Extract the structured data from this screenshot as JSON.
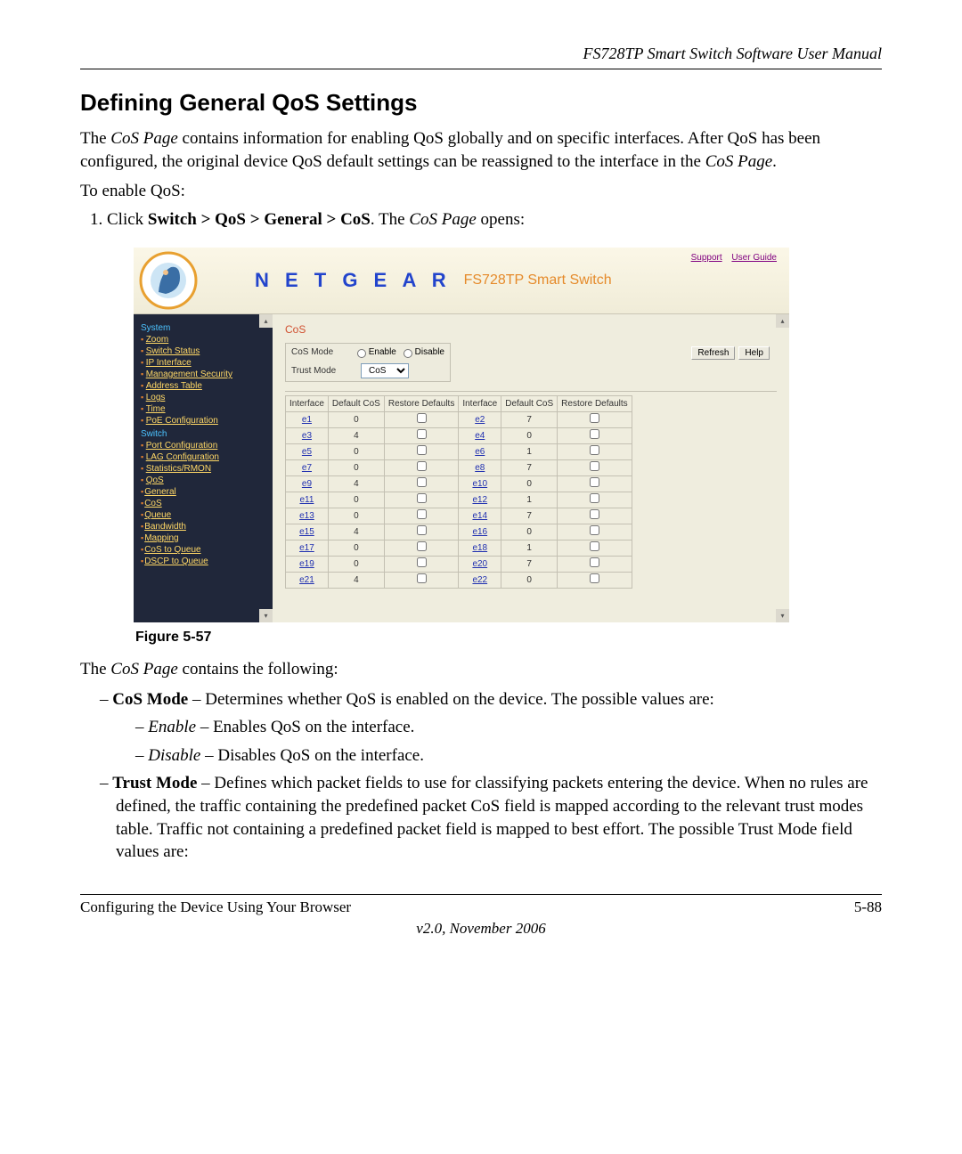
{
  "doc": {
    "header_title": "FS728TP Smart Switch Software User Manual",
    "section_heading": "Defining General QoS Settings",
    "intro_p1_a": "The ",
    "intro_p1_b": "CoS Page",
    "intro_p1_c": " contains information for enabling QoS globally and on specific interfaces. After QoS has been configured, the original device QoS default settings can be reassigned to the interface in the ",
    "intro_p1_d": "CoS Page",
    "intro_p1_e": ".",
    "enable_line": "To enable QoS:",
    "step1_a": "Click ",
    "step1_b": "Switch > QoS > General > CoS",
    "step1_c": ". The ",
    "step1_d": "CoS Page",
    "step1_e": " opens:",
    "figure_caption": "Figure 5-57",
    "contains_line_a": "The ",
    "contains_line_b": "CoS Page",
    "contains_line_c": " contains the following:",
    "bullets": {
      "cos_mode_label": "CoS Mode",
      "cos_mode_text": " – Determines whether QoS is enabled on the device. The possible values are:",
      "enable_label": "Enable",
      "enable_text": " – Enables QoS on the interface.",
      "disable_label": "Disable",
      "disable_text": " – Disables QoS on the interface.",
      "trust_mode_label": "Trust Mode",
      "trust_mode_text": " – Defines which packet fields to use for classifying packets entering the device. When no rules are defined, the traffic containing the predefined packet CoS field is mapped according to the relevant trust modes table. Traffic not containing a predefined packet field is mapped to best effort. The possible Trust Mode field values are:"
    },
    "footer_left": "Configuring the Device Using Your Browser",
    "footer_right": "5-88",
    "footer_version": "v2.0, November 2006"
  },
  "screenshot": {
    "brand": "N E T G E A R",
    "product": "FS728TP Smart Switch",
    "top_links": {
      "support": "Support",
      "user_guide": "User Guide"
    },
    "sidebar": {
      "group_system": "System",
      "items_system": [
        "Zoom",
        "Switch Status",
        "IP Interface",
        "Management Security",
        "Address Table",
        "Logs",
        "Time",
        "PoE Configuration"
      ],
      "group_switch": "Switch",
      "items_switch": [
        "Port Configuration",
        "LAG Configuration",
        "Statistics/RMON",
        "QoS"
      ],
      "general_label": "General",
      "general_children": [
        "CoS",
        "Queue",
        "Bandwidth"
      ],
      "mapping_label": "Mapping",
      "mapping_children": [
        "CoS to Queue",
        "DSCP to Queue"
      ]
    },
    "panel": {
      "title": "CoS",
      "refresh": "Refresh",
      "help": "Help",
      "form": {
        "cos_mode_label": "CoS Mode",
        "enable": "Enable",
        "disable": "Disable",
        "trust_mode_label": "Trust Mode",
        "trust_select": "CoS"
      },
      "table": {
        "headers": [
          "Interface",
          "Default CoS",
          "Restore Defaults",
          "Interface",
          "Default CoS",
          "Restore Defaults"
        ],
        "rows": [
          {
            "l_if": "e1",
            "l_cos": "0",
            "r_if": "e2",
            "r_cos": "7"
          },
          {
            "l_if": "e3",
            "l_cos": "4",
            "r_if": "e4",
            "r_cos": "0"
          },
          {
            "l_if": "e5",
            "l_cos": "0",
            "r_if": "e6",
            "r_cos": "1"
          },
          {
            "l_if": "e7",
            "l_cos": "0",
            "r_if": "e8",
            "r_cos": "7"
          },
          {
            "l_if": "e9",
            "l_cos": "4",
            "r_if": "e10",
            "r_cos": "0"
          },
          {
            "l_if": "e11",
            "l_cos": "0",
            "r_if": "e12",
            "r_cos": "1"
          },
          {
            "l_if": "e13",
            "l_cos": "0",
            "r_if": "e14",
            "r_cos": "7"
          },
          {
            "l_if": "e15",
            "l_cos": "4",
            "r_if": "e16",
            "r_cos": "0"
          },
          {
            "l_if": "e17",
            "l_cos": "0",
            "r_if": "e18",
            "r_cos": "1"
          },
          {
            "l_if": "e19",
            "l_cos": "0",
            "r_if": "e20",
            "r_cos": "7"
          },
          {
            "l_if": "e21",
            "l_cos": "4",
            "r_if": "e22",
            "r_cos": "0"
          }
        ]
      }
    }
  }
}
